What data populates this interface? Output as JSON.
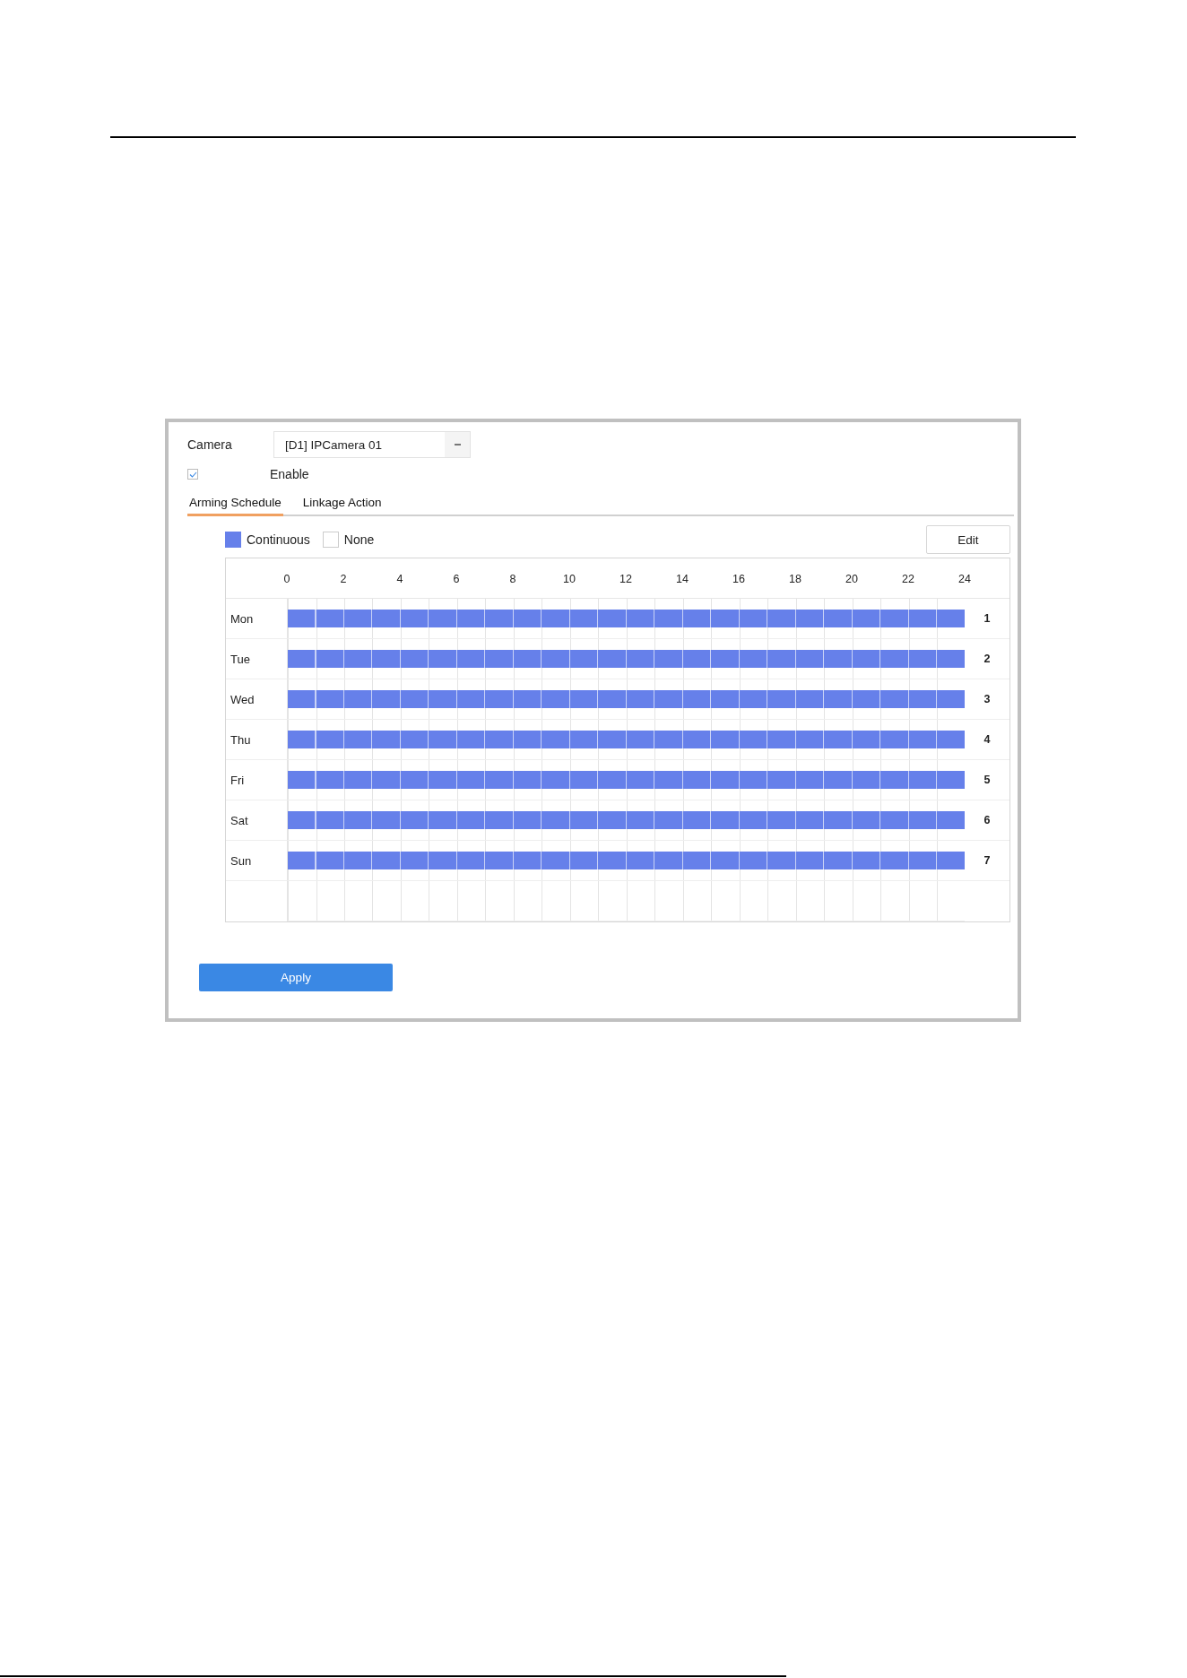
{
  "camera": {
    "label": "Camera",
    "value": "[D1] IPCamera 01"
  },
  "enable": {
    "label": "Enable",
    "checked": true
  },
  "tabs": [
    {
      "label": "Arming Schedule",
      "selected": true
    },
    {
      "label": "Linkage Action",
      "selected": false
    }
  ],
  "legend": [
    {
      "label": "Continuous",
      "color": "#6680ea"
    },
    {
      "label": "None",
      "color": "#ffffff"
    }
  ],
  "edit_button": "Edit",
  "schedule": {
    "hours": [
      "0",
      "2",
      "4",
      "6",
      "8",
      "10",
      "12",
      "14",
      "16",
      "18",
      "20",
      "22",
      "24"
    ],
    "days": [
      {
        "name": "Mon",
        "number": "1",
        "level": 1
      },
      {
        "name": "Tue",
        "number": "2",
        "level": 1
      },
      {
        "name": "Wed",
        "number": "3",
        "level": 1
      },
      {
        "name": "Thu",
        "number": "4",
        "level": 1
      },
      {
        "name": "Fri",
        "number": "5",
        "level": 1
      },
      {
        "name": "Sat",
        "number": "6",
        "level": 1
      },
      {
        "name": "Sun",
        "number": "7",
        "level": 1
      }
    ]
  },
  "apply_button": "Apply"
}
